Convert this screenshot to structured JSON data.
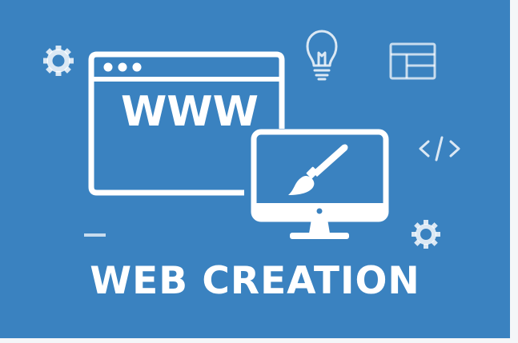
{
  "banner": {
    "headline": "WEB CREATION",
    "browser_text": "WWW",
    "background_color": "#3a82c0",
    "foreground_color": "#ffffff",
    "icons": [
      "gear-icon",
      "lightbulb-icon",
      "layout-icon",
      "code-icon",
      "browser-window-icon",
      "monitor-icon",
      "paintbrush-icon",
      "dash-icon"
    ]
  }
}
